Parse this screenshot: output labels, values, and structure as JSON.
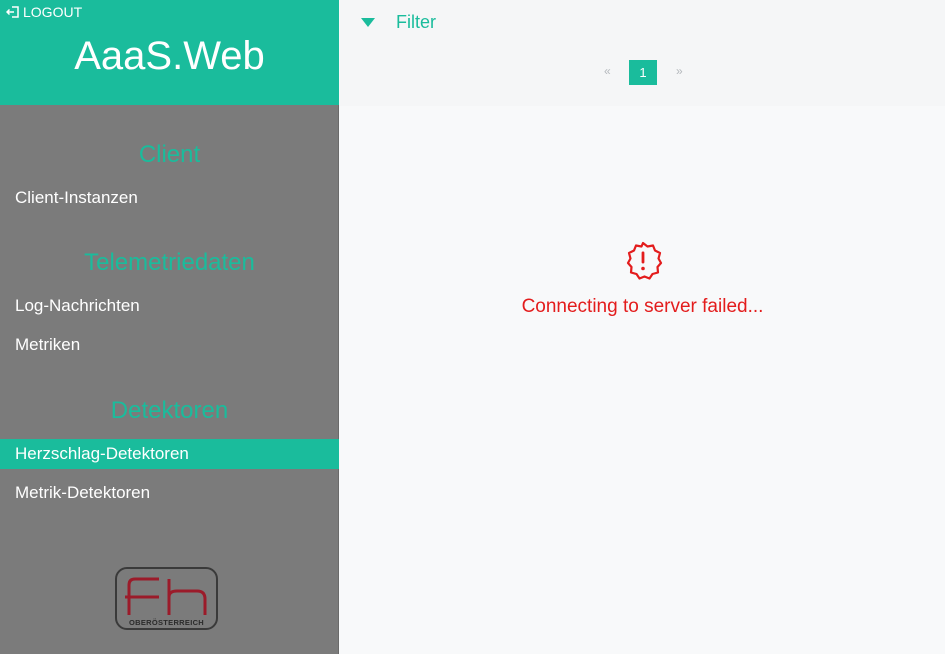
{
  "sidebar": {
    "logout_label": "LOGOUT",
    "brand_title": "AaaS.Web",
    "sections": [
      {
        "heading": "Client",
        "items": [
          "Client-Instanzen"
        ]
      },
      {
        "heading": "Telemetriedaten",
        "items": [
          "Log-Nachrichten",
          "Metriken"
        ]
      },
      {
        "heading": "Detektoren",
        "items": [
          "Herzschlag-Detektoren",
          "Metrik-Detektoren"
        ]
      }
    ],
    "active_item": "Herzschlag-Detektoren",
    "logo": {
      "text": "fh",
      "caption": "OBERÖSTERREICH"
    }
  },
  "main": {
    "filter_label": "Filter",
    "pagination": {
      "prev": "«",
      "current": "1",
      "next": "»"
    },
    "error_message": "Connecting to server failed..."
  },
  "colors": {
    "accent": "#1abc9c",
    "sidebar_bg": "#7b7b7b",
    "error": "#e31c1c",
    "logo_red": "#9b1b2a"
  },
  "icons": {
    "logout": "logout-icon",
    "filter_toggle": "triangle-down-icon",
    "error": "exclamation-badge-icon"
  }
}
